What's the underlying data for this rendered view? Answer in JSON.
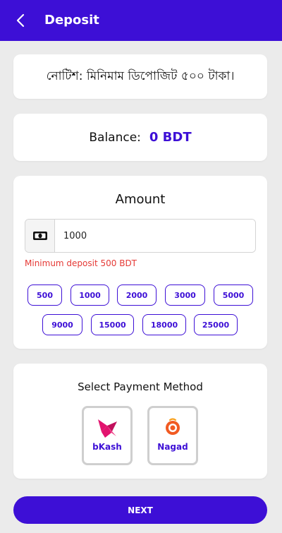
{
  "header": {
    "title": "Deposit"
  },
  "notice": {
    "text": "নোটিশ: মিনিমাম ডিপোজিট ৫০০ টাকা।"
  },
  "balance": {
    "label": "Balance:",
    "value": "0 BDT"
  },
  "amount": {
    "title": "Amount",
    "input_value": "1000",
    "min_message": "Minimum deposit 500 BDT",
    "chips_row1": [
      "500",
      "1000",
      "2000",
      "3000",
      "5000"
    ],
    "chips_row2": [
      "9000",
      "15000",
      "18000",
      "25000"
    ]
  },
  "payment": {
    "title": "Select Payment Method",
    "methods": [
      {
        "label": "bKash",
        "icon": "bkash-logo-icon"
      },
      {
        "label": "Nagad",
        "icon": "nagad-logo-icon"
      }
    ]
  },
  "next_button": {
    "label": "NEXT"
  },
  "colors": {
    "primary": "#3d0fd6",
    "error": "#e53935",
    "background": "#ebebeb",
    "bkash": "#e2136e",
    "nagad": "#f15a22"
  }
}
